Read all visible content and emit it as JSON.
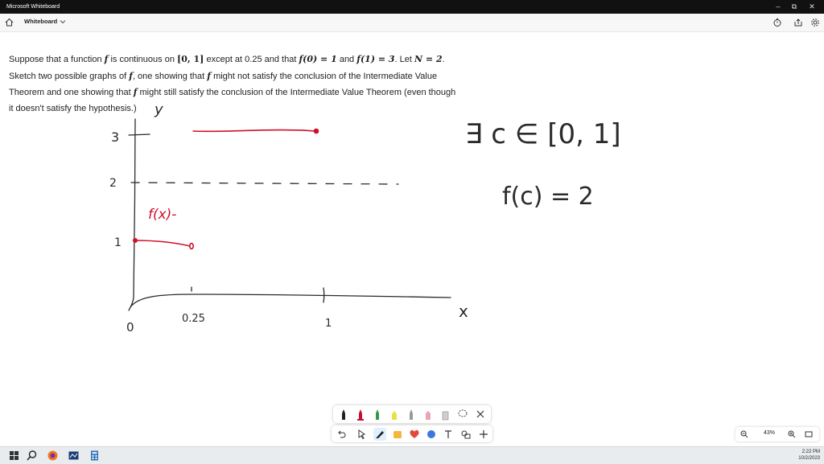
{
  "window": {
    "app_title": "Microsoft Whiteboard",
    "minimize": "–",
    "maximize": "⧉",
    "close": "✕"
  },
  "header": {
    "board_name": "Whiteboard"
  },
  "problem": {
    "t1": "Suppose that a function ",
    "f": "f",
    "t2": " is continuous on ",
    "interval": "[0, 1]",
    "t3": " except at 0.25 and that ",
    "f0": "f(0) = 1",
    "t4": " and ",
    "f1": "f(1) = 3",
    "t5": ". Let ",
    "N": "N = 2",
    "t6": ".",
    "t7": "Sketch two possible graphs of ",
    "t8": ", one showing that ",
    "t9": " might not satisfy the conclusion of the Intermediate Value",
    "t10": "Theorem and one showing that ",
    "t11": " might still satisfy the conclusion of the Intermediate Value Theorem (even though",
    "t12": "it doesn't satisfy the hypothesis.)"
  },
  "handwriting": {
    "y_axis": "y",
    "x_axis": "x",
    "tick_3": "3",
    "tick_2": "2",
    "tick_1": "1",
    "origin": "0",
    "x_tick_025": "0.25",
    "x_tick_1": "1",
    "fx_label": "f(x)-",
    "exists": "∃ c ∈ [0, 1]",
    "fc": "f(c) = 2"
  },
  "colors": {
    "pen_black": "#2a2a2a",
    "pen_red": "#d0102a",
    "titlebar": "#111111",
    "accent_pen": "#dff1ff"
  },
  "zoom": {
    "level": "43%"
  },
  "clock": {
    "time": "2:22 PM",
    "date": "10/2/2023"
  },
  "toolbar_icons": [
    "black-pen-icon",
    "red-pen-icon",
    "green-pen-icon",
    "yellow-highlighter-icon",
    "gray-pen-icon",
    "pink-pen-icon",
    "eraser-icon",
    "lasso-icon",
    "close-icon"
  ],
  "toolbar2_icons": [
    "undo-icon",
    "select-icon",
    "ink-icon",
    "sticky-note-icon",
    "reaction-icon",
    "shapes-icon",
    "text-icon",
    "more-icon",
    "add-icon"
  ]
}
